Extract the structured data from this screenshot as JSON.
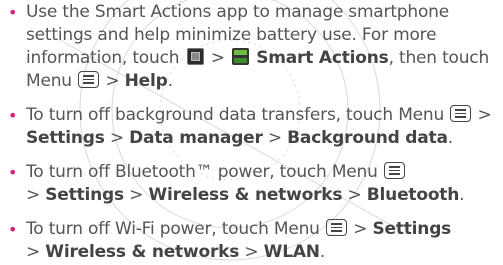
{
  "colors": {
    "bullet": "#d71f7b",
    "text": "#555555",
    "bold": "#444444"
  },
  "icons": {
    "menu": "menu-key-icon",
    "apps": "apps-launcher-icon",
    "smart_actions": "smart-actions-app-icon"
  },
  "items": [
    {
      "t1": "Use the Smart Actions app to manage smartphone settings and help minimize battery use. For more information, touch",
      "sep1": ">",
      "b1": "Smart Actions",
      "t2": ", then touch Menu",
      "sep2": ">",
      "b2": "Help",
      "end": "."
    },
    {
      "t1": "To turn off background data transfers, touch Menu",
      "sep1": ">",
      "b1": "Settings",
      "sep2": ">",
      "b2": "Data manager",
      "sep3": ">",
      "b3": "Background data",
      "end": "."
    },
    {
      "t1": "To turn off Bluetooth™ power, touch Menu",
      "sep1": ">",
      "b1": "Settings",
      "sep2": ">",
      "b2": "Wireless & networks",
      "sep3": ">",
      "b3": "Bluetooth",
      "end": "."
    },
    {
      "t1": "To turn off Wi-Fi power, touch Menu",
      "sep1": ">",
      "b1": "Settings",
      "sep2": ">",
      "b2": "Wireless & networks",
      "sep3": ">",
      "b3": "WLAN",
      "end": "."
    }
  ]
}
